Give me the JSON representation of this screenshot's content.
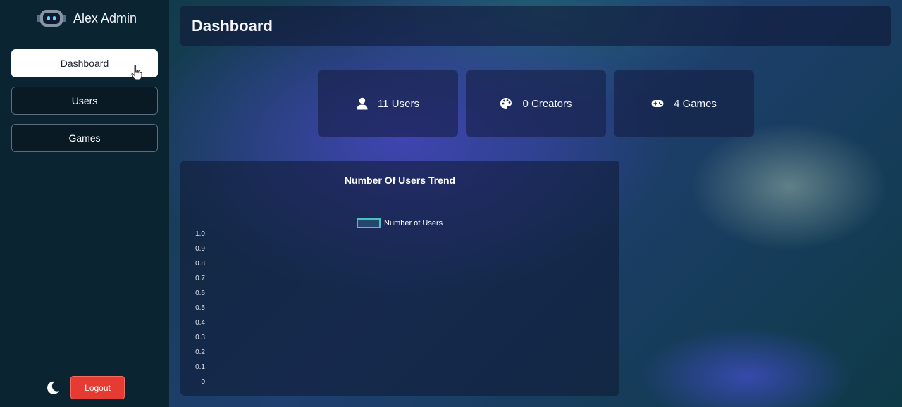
{
  "sidebar": {
    "brand_name": "Alex Admin",
    "nav": [
      {
        "label": "Dashboard",
        "active": true
      },
      {
        "label": "Users",
        "active": false
      },
      {
        "label": "Games",
        "active": false
      }
    ],
    "logout_label": "Logout",
    "theme_icon": "moon-icon"
  },
  "header": {
    "title": "Dashboard"
  },
  "stats": [
    {
      "icon": "user-icon",
      "label": "11 Users"
    },
    {
      "icon": "palette-icon",
      "label": "0 Creators"
    },
    {
      "icon": "gamepad-icon",
      "label": "4 Games"
    }
  ],
  "colors": {
    "logout": "#e53b32",
    "series": "#4bc0c0"
  },
  "chart_data": {
    "type": "line",
    "title": "Number Of Users Trend",
    "series": [
      {
        "name": "Number of Users",
        "values": []
      }
    ],
    "categories": [],
    "ylim": [
      0,
      1
    ],
    "y_ticks": [
      "1.0",
      "0.9",
      "0.8",
      "0.7",
      "0.6",
      "0.5",
      "0.4",
      "0.3",
      "0.2",
      "0.1",
      "0"
    ],
    "legend_position": "top",
    "grid": false
  }
}
